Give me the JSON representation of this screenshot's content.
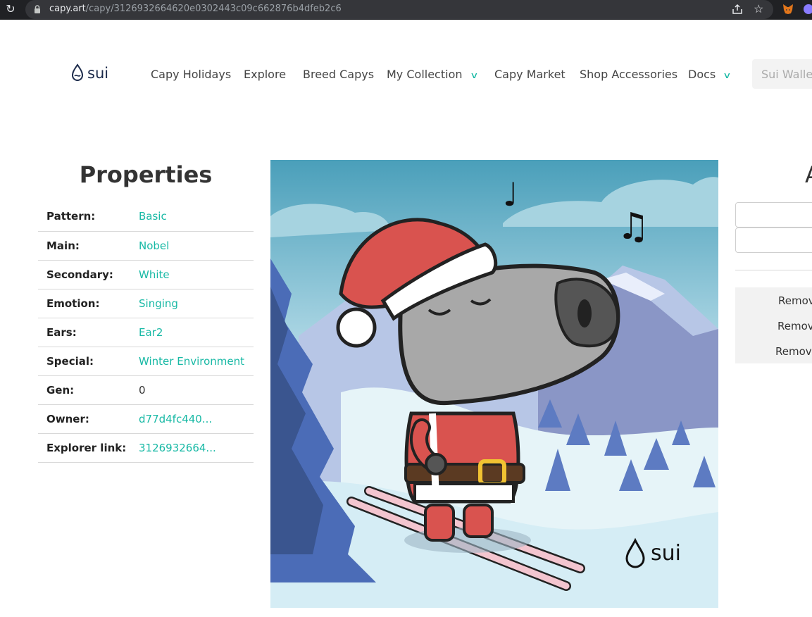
{
  "browser": {
    "url_host": "capy.art",
    "url_path": "/capy/3126932664620e0302443c09c662876b4dfeb2c6"
  },
  "nav": {
    "logo_text": "sui",
    "items": [
      {
        "label": "Capy Holidays"
      },
      {
        "label": "Explore"
      },
      {
        "label": "Breed Capys"
      },
      {
        "label": "My Collection",
        "dropdown": true
      },
      {
        "label": "Capy Market"
      },
      {
        "label": "Shop Accessories"
      },
      {
        "label": "Docs",
        "dropdown": true
      }
    ],
    "wallet_label": "Sui Wallet"
  },
  "properties": {
    "title": "Properties",
    "rows": [
      {
        "key": "Pattern:",
        "value": "Basic"
      },
      {
        "key": "Main:",
        "value": "Nobel"
      },
      {
        "key": "Secondary:",
        "value": "White"
      },
      {
        "key": "Emotion:",
        "value": "Singing"
      },
      {
        "key": "Ears:",
        "value": "Ear2"
      },
      {
        "key": "Special:",
        "value": "Winter Environment"
      },
      {
        "key": "Gen:",
        "value": "0"
      },
      {
        "key": "Owner:",
        "value": "d77d4fc440..."
      },
      {
        "key": "Explorer link:",
        "value": "3126932664..."
      }
    ]
  },
  "image": {
    "watermark": "sui",
    "notes": [
      "♩",
      "♫"
    ]
  },
  "right_panel": {
    "title_partial": "A",
    "remove_labels": [
      "Remov",
      "Remov",
      "Remove"
    ]
  },
  "colors": {
    "accent": "#18b9a5",
    "browser_dark": "#202124"
  }
}
